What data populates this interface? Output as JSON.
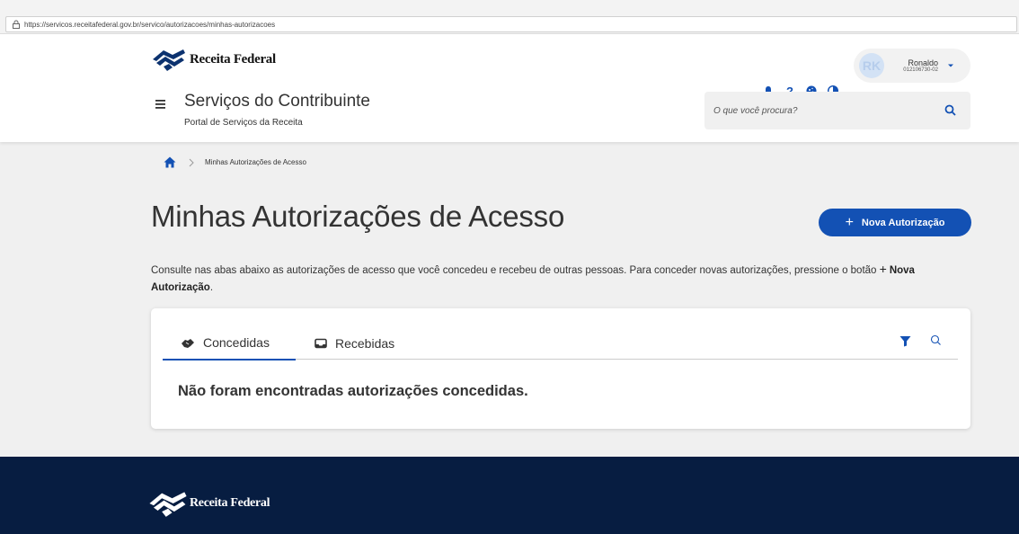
{
  "browser": {
    "url": "https://servicos.receitafederal.gov.br/servico/autorizacoes/minhas-autorizacoes"
  },
  "header": {
    "logo_text": "Receita Federal",
    "site_title": "Serviços do Contribuinte",
    "site_subtitle": "Portal de Serviços da Receita",
    "icons": [
      "bell-icon",
      "help-icon",
      "cookie-icon",
      "contrast-icon"
    ],
    "help_glyph": "?",
    "user": {
      "initials": "RK",
      "name": "Ronaldo",
      "cpf": "012106730-02"
    },
    "search": {
      "placeholder": "O que você procura?"
    }
  },
  "breadcrumb": {
    "current": "Minhas Autorizações de Acesso"
  },
  "main": {
    "title": "Minhas Autorizações de Acesso",
    "new_button_label": "Nova Autorização",
    "new_button_plus": "+",
    "description_text": "Consulte nas abas abaixo as autorizações de acesso que você concedeu e recebeu de outras pessoas. Para conceder novas autorizações, pressione o botão ",
    "description_button_ref": "Nova Autorização",
    "description_end": ".",
    "tabs": [
      {
        "label": "Concedidas",
        "active": true
      },
      {
        "label": "Recebidas",
        "active": false
      }
    ],
    "empty_message": "Não foram encontradas autorizações concedidas."
  },
  "footer": {
    "logo_text": "Receita Federal"
  },
  "colors": {
    "primary": "#1351b4",
    "footer_bg": "#071d41"
  }
}
